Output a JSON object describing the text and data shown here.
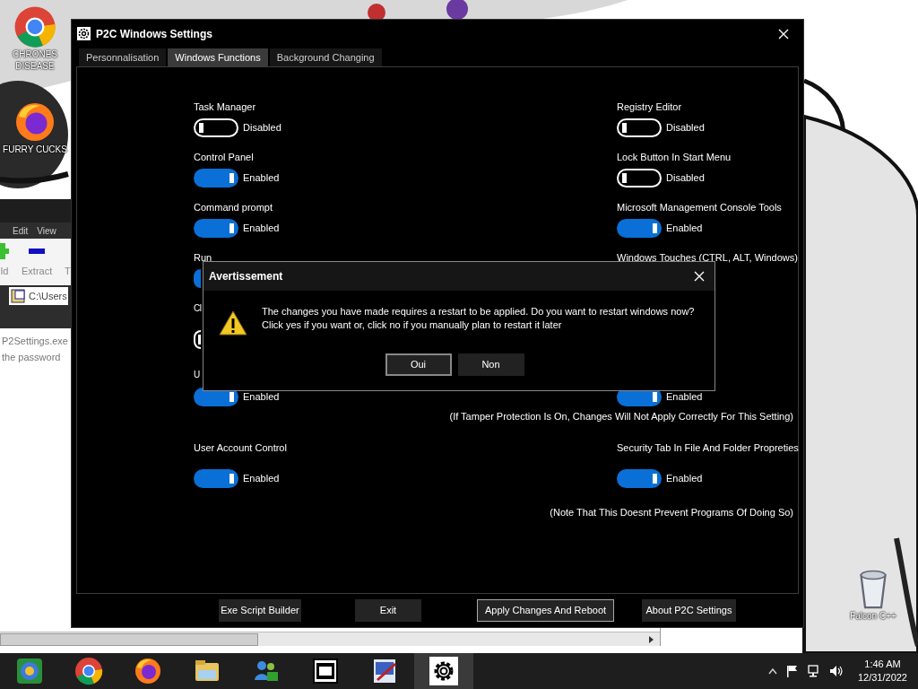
{
  "desktop_icons": [
    {
      "kind": "chrome",
      "label": "CHRONES DISEASE"
    },
    {
      "kind": "firefox",
      "label": "FURRY CUCKS"
    },
    {
      "kind": "bin",
      "label": "Falcon C++"
    }
  ],
  "background_window": {
    "menu": [
      "Edit",
      "View"
    ],
    "toolbar": [
      {
        "kind": "add",
        "label": "ld"
      },
      {
        "kind": "extract",
        "label": "Extract"
      },
      {
        "kind": "test",
        "label": "T"
      }
    ],
    "address": "C:\\Users",
    "rows": [
      "P2Settings.exe",
      "the password"
    ]
  },
  "window": {
    "title": "P2C Windows Settings",
    "tabs": [
      {
        "label": "Personnalisation",
        "selected": false
      },
      {
        "label": "Windows Functions",
        "selected": true
      },
      {
        "label": "Background Changing",
        "selected": false
      }
    ],
    "rows": [
      {
        "left": {
          "label": "Task Manager",
          "on": false,
          "status": "Disabled"
        },
        "right": {
          "label": "Registry Editor",
          "on": false,
          "status": "Disabled"
        }
      },
      {
        "left": {
          "label": "Control Panel",
          "on": true,
          "status": "Enabled"
        },
        "right": {
          "label": "Lock Button In Start Menu",
          "on": false,
          "status": "Disabled"
        }
      },
      {
        "left": {
          "label": "Command prompt",
          "on": true,
          "status": "Enabled"
        },
        "right": {
          "label": "Microsoft Management Console Tools",
          "on": true,
          "status": "Enabled"
        }
      },
      {
        "left": {
          "label": "Run",
          "on": true
        },
        "right": {
          "label": "Windows Touches (CTRL, ALT, Windows)"
        }
      },
      {
        "left": {
          "label": "Cl",
          "on": false
        },
        "right": {}
      },
      {
        "left": {
          "label": "U",
          "on": true,
          "status": "Enabled"
        },
        "right": {
          "on": true,
          "status": "Enabled",
          "note": "(If Tamper Protection Is On, Changes Will Not Apply Correctly For This Setting)"
        }
      },
      {
        "left": {
          "label": "User Account Control",
          "on": true,
          "status": "Enabled"
        },
        "right": {
          "label": "Security Tab In File And Folder Propreties",
          "on": true,
          "status": "Enabled",
          "note": "(Note That This Doesnt Prevent Programs Of Doing So)"
        }
      }
    ],
    "buttons": [
      {
        "label": "Exe Script Builder",
        "focused": false
      },
      {
        "label": "Exit",
        "focused": false
      },
      {
        "label": "Apply Changes And Reboot",
        "focused": true
      },
      {
        "label": "About P2C Settings",
        "focused": false
      }
    ]
  },
  "dialog": {
    "title": "Avertissement",
    "message": "The changes you have made requires a restart to be applied. Do you want to restart windows now? Click yes if you want or, click no if you manually plan to restart it later",
    "buttons": [
      {
        "label": "Oui",
        "focused": true
      },
      {
        "label": "Non",
        "focused": false
      }
    ]
  },
  "taskbar": {
    "apps": [
      {
        "kind": "ie",
        "active": false
      },
      {
        "kind": "chrome",
        "active": false
      },
      {
        "kind": "firefox",
        "active": false
      },
      {
        "kind": "explorer",
        "active": false
      },
      {
        "kind": "people",
        "active": false
      },
      {
        "kind": "sevenzip",
        "active": false
      },
      {
        "kind": "paint",
        "active": false
      },
      {
        "kind": "settings",
        "active": true
      }
    ],
    "time": "1:46 AM",
    "date": "12/31/2022"
  }
}
